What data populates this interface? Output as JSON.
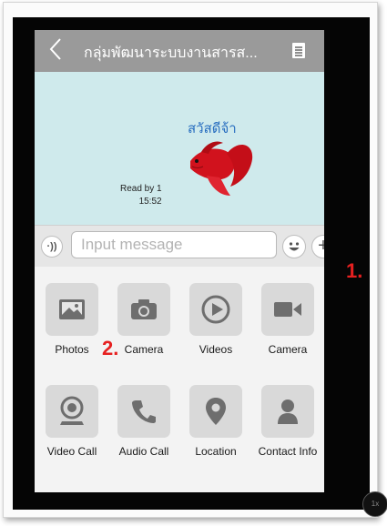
{
  "header": {
    "title": "กลุ่มพัฒนาระบบงานสารส...",
    "back_glyph": "<"
  },
  "chat": {
    "message_text": "สวัสดีจ้า",
    "read_status": "Read by 1",
    "time": "15:52"
  },
  "input_bar": {
    "voice_label": "·))",
    "placeholder": "Input message",
    "plus_glyph": "+"
  },
  "annotations": {
    "step1": "1.",
    "step2": "2."
  },
  "actions": [
    {
      "label": "Photos",
      "icon": "photo-icon"
    },
    {
      "label": "Camera",
      "icon": "camera-icon"
    },
    {
      "label": "Videos",
      "icon": "play-icon"
    },
    {
      "label": "Camera",
      "icon": "video-camera-icon"
    },
    {
      "label": "Video Call",
      "icon": "webcam-icon"
    },
    {
      "label": "Audio Call",
      "icon": "phone-icon"
    },
    {
      "label": "Location",
      "icon": "location-pin-icon"
    },
    {
      "label": "Contact Info",
      "icon": "person-icon"
    }
  ],
  "colors": {
    "header_bg": "#9a9a9a",
    "chat_bg": "#cfeaec",
    "annotation": "#e62020",
    "icon_fg": "#6e6e6e"
  },
  "corner_badge": "1x"
}
